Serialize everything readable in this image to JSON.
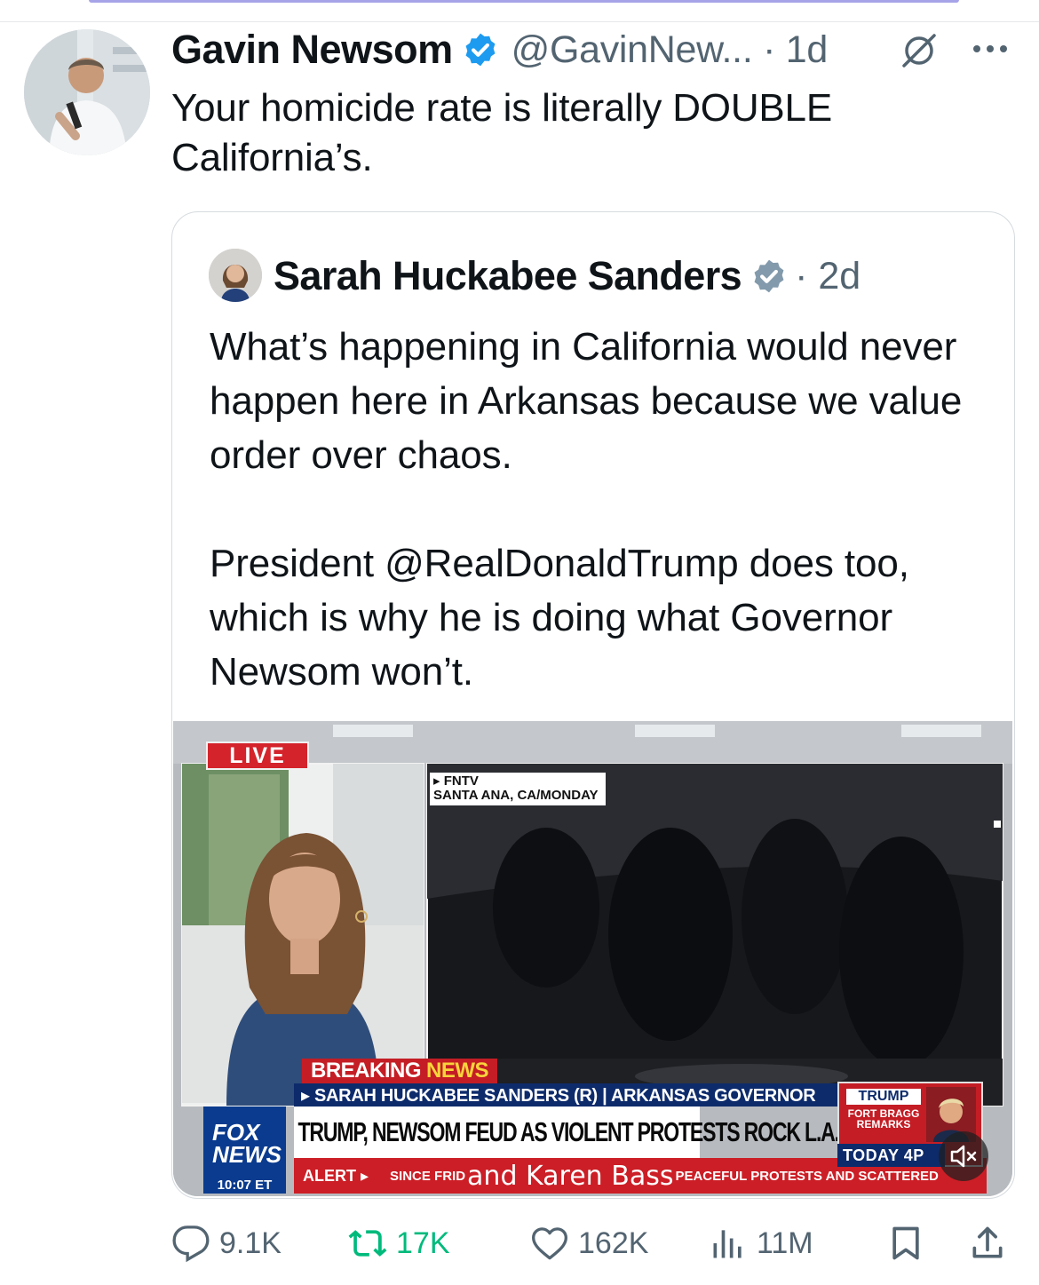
{
  "tweet": {
    "author_name": "Gavin Newsom",
    "handle_time": "@GavinNew... · 1d",
    "text": "Your homicide rate is literally DOUBLE California’s."
  },
  "quote": {
    "author_name": "Sarah Huckabee Sanders",
    "time": "· 2d",
    "paragraph1": "What’s happening in California would never happen here in Arkansas because we value order over chaos.",
    "paragraph2": "President @RealDonaldTrump does too, which is why he is doing what Governor Newsom won’t."
  },
  "video": {
    "live": "LIVE",
    "source_line1": "▸ FNTV",
    "source_line2": "SANTA ANA, CA/MONDAY",
    "breaking": "BREAKING",
    "breaking_news": "NEWS",
    "name_bar": "▸ SARAH HUCKABEE SANDERS (R) | ARKANSAS GOVERNOR",
    "headline": "TRUMP, NEWSOM FEUD AS VIOLENT PROTESTS ROCK L.A.",
    "logo_line1": "FOX",
    "logo_line2": "NEWS",
    "time": "10:07 ET",
    "alert": "ALERT ▸",
    "ticker_left": "SINCE FRID",
    "caption": "and Karen Bass",
    "ticker_right": "PEACEFUL PROTESTS AND SCATTERED",
    "trump_title": "TRUMP",
    "trump_sub": "FORT BRAGG REMARKS",
    "today": "TODAY 4P"
  },
  "actions": {
    "replies": "9.1K",
    "reposts": "17K",
    "likes": "162K",
    "views": "11M"
  },
  "colors": {
    "verified": "#1d9bf0",
    "quote_verified": "#829aab",
    "repost": "#00ba7c",
    "muted_text": "#536471"
  }
}
